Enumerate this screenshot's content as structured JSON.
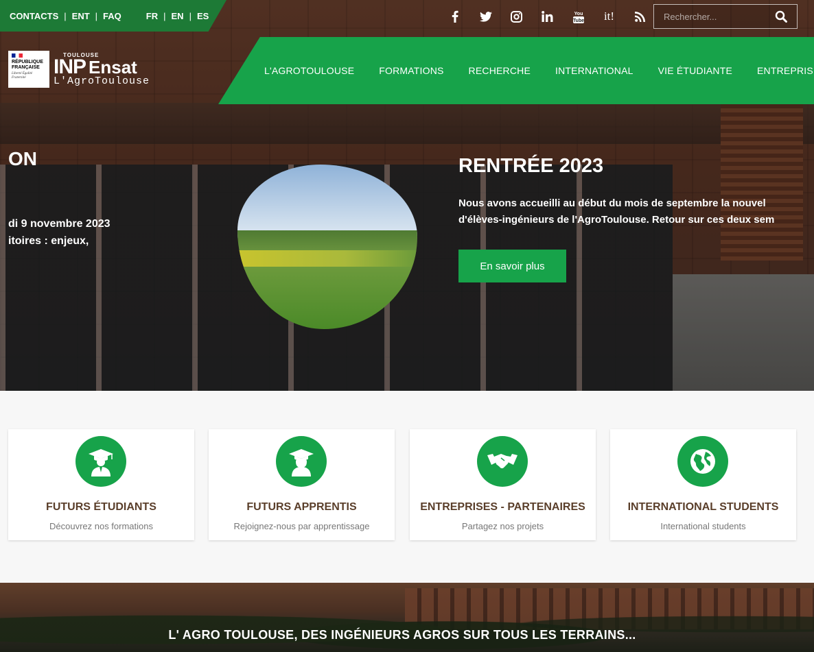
{
  "topbar": {
    "links": [
      "CONTACTS",
      "ENT",
      "FAQ"
    ],
    "langs": [
      "FR",
      "EN",
      "ES"
    ]
  },
  "social": {
    "icons": [
      "facebook-icon",
      "twitter-icon",
      "instagram-icon",
      "linkedin-icon",
      "youtube-icon",
      "scoopit-icon",
      "rss-icon"
    ],
    "scoopit_text": "it!",
    "youtube_text": "You Tube"
  },
  "search": {
    "placeholder": "Rechercher..."
  },
  "logo": {
    "republique": "RÉPUBLIQUE FRANÇAISE",
    "motto": "Liberté Égalité Fraternité",
    "toulouse": "TOULOUSE",
    "inp": "INP",
    "ensat": "Ensat",
    "agro": "L'AgroToulouse"
  },
  "nav": {
    "items": [
      "L'AGROTOULOUSE",
      "FORMATIONS",
      "RECHERCHE",
      "INTERNATIONAL",
      "VIE ÉTUDIANTE",
      "ENTREPRISES"
    ]
  },
  "slide_left": {
    "title": "ON",
    "date": "di 9 novembre 2023",
    "desc": "itoires : enjeux,"
  },
  "slide_right": {
    "title": "RENTRÉE 2023",
    "line1": "Nous avons accueilli au début du mois de septembre la nouvel",
    "line2": "d'élèves-ingénieurs de l'AgroToulouse. Retour sur ces deux sem",
    "button": "En savoir plus"
  },
  "cards": [
    {
      "title": "FUTURS ÉTUDIANTS",
      "subtitle": "Découvrez nos formations",
      "icon": "graduate-icon"
    },
    {
      "title": "FUTURS APPRENTIS",
      "subtitle": "Rejoignez-nous par apprentissage",
      "icon": "graduate-female-icon"
    },
    {
      "title": "ENTREPRISES - PARTENAIRES",
      "subtitle": "Partagez nos projets",
      "icon": "handshake-icon"
    },
    {
      "title": "INTERNATIONAL STUDENTS",
      "subtitle": "International students",
      "icon": "globe-icon"
    }
  ],
  "banner": {
    "text": "L' AGRO TOULOUSE, DES INGÉNIEURS AGROS SUR TOUS LES TERRAINS..."
  },
  "colors": {
    "green": "#17a34a",
    "dark_green": "#1d7a36",
    "card_title": "#5a3e2a"
  }
}
